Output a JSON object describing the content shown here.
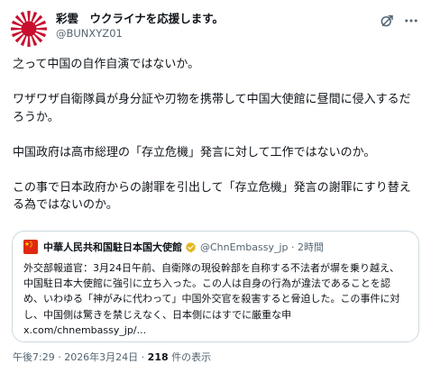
{
  "author": {
    "display_name": "彩雲　ウクライナを応援します。",
    "handle": "@BUNXYZ01"
  },
  "post": {
    "paragraphs": [
      "之って中国の自作自演ではないか。",
      "ワザワザ自衛隊員が身分証や刃物を携帯して中国大使館に昼間に侵入するだろうか。",
      "中国政府は高市総理の「存立危機」発言に対して工作ではないのか。",
      "この事で日本政府からの謝罪を引出して「存立危機」発言の謝罪にすり替える為ではないのか。"
    ]
  },
  "quoted_post": {
    "display_name": "中華人民共和国駐日本国大使館",
    "handle": "@ChnEmbassy_jp",
    "time": "2時間",
    "text": "外交部報道官：3月24日午前、自衛隊の現役幹部を自称する不法者が塀を乗り越え、中国駐日本大使館に強引に立ち入った。この人は自身の行為が違法であることを認め、いわゆる「神がみに代わって」中国外交官を殺害すると脅迫した。この事件に対し、中国側は驚きを禁じえなく、日本側にはすでに厳重な申x.com/chnembassy_jp/..."
  },
  "footer": {
    "timestamp": "午後7:29 · 2026年3月24日 · ",
    "views_count": "218",
    "views_label": " 件の表示"
  },
  "icons": {
    "grok": "grok-icon",
    "more": "more-icon",
    "verified": "verified-badge-icon"
  },
  "colors": {
    "text": "#0f1419",
    "secondary": "#536471",
    "border": "#cfd9de",
    "rising_sun_red": "#c8102e",
    "verified_gold": "#e2b719"
  }
}
